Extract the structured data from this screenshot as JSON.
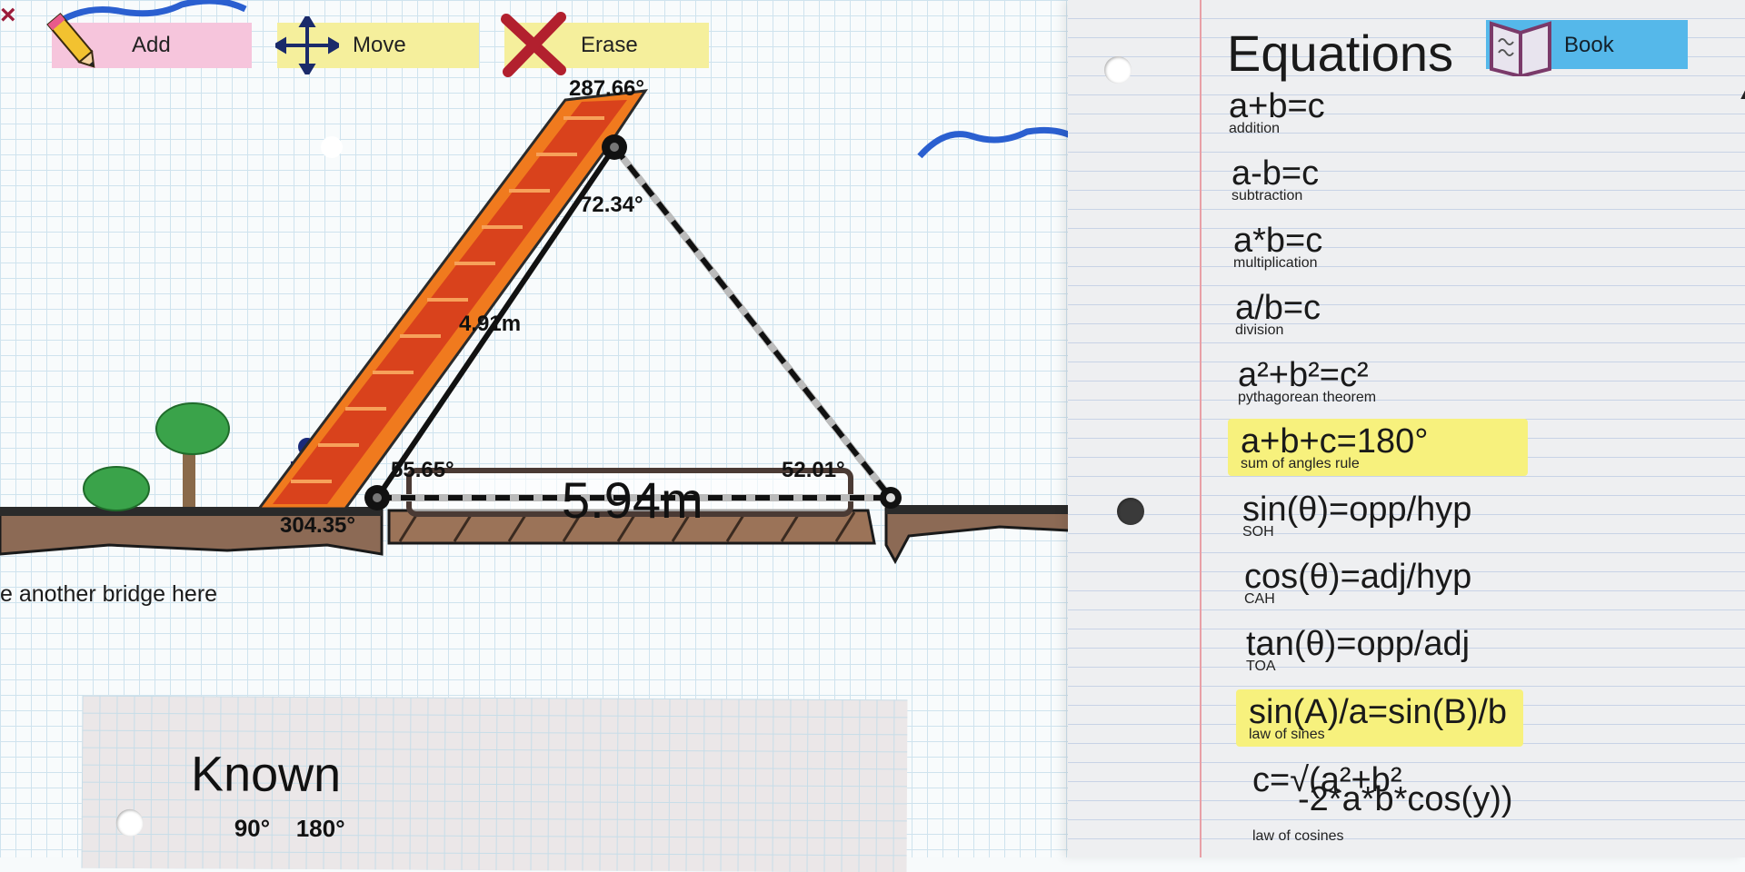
{
  "toolbar": {
    "add_label": "Add",
    "move_label": "Move",
    "erase_label": "Erase"
  },
  "close": {
    "symbol": "×"
  },
  "measurements": {
    "top_angle": "287.66°",
    "apex_angle": "72.34°",
    "ladder_length": "4.91m",
    "left_angle": "55.65°",
    "left_outer_angle": "304.35°",
    "right_angle": "52.01°",
    "gap_length": "5.94m"
  },
  "hint": "e another bridge here",
  "known": {
    "title": "Known",
    "values": [
      "90°",
      "180°"
    ]
  },
  "equations": {
    "title": "Equations",
    "book_label": "Book",
    "items": [
      {
        "formula": "a+b=c",
        "name": "addition",
        "highlight": false
      },
      {
        "formula": "a-b=c",
        "name": "subtraction",
        "highlight": false
      },
      {
        "formula": "a*b=c",
        "name": "multiplication",
        "highlight": false
      },
      {
        "formula": "a/b=c",
        "name": "division",
        "highlight": false
      },
      {
        "formula": "a²+b²=c²",
        "name": "pythagorean theorem",
        "highlight": false
      },
      {
        "formula": "a+b+c=180°",
        "name": "sum of angles rule",
        "highlight": true
      },
      {
        "formula": "sin(θ)=opp/hyp",
        "name": "SOH",
        "highlight": false
      },
      {
        "formula": "cos(θ)=adj/hyp",
        "name": "CAH",
        "highlight": false
      },
      {
        "formula": "tan(θ)=opp/adj",
        "name": "TOA",
        "highlight": false
      },
      {
        "formula": "sin(A)/a=sin(B)/b",
        "name": "law of sines",
        "highlight": true
      },
      {
        "formula": "c=√(a²+b²",
        "formula2": "-2*a*b*cos(y))",
        "name": "law of cosines",
        "highlight": false
      }
    ]
  },
  "colors": {
    "add_button": "#f6c5dc",
    "tool_button": "#f5ef9c",
    "book_button": "#55b8ea",
    "highlight": "#f7f17d",
    "ladder": "#f07a1e",
    "ground": "#8c6a55"
  }
}
